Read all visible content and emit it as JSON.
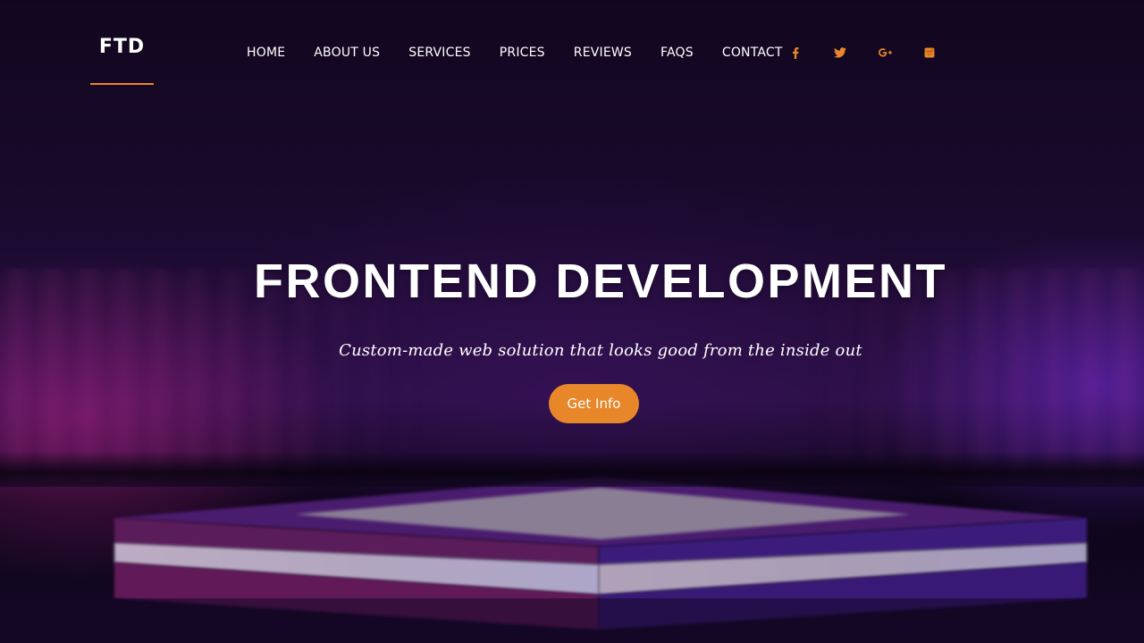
{
  "header": {
    "logo": "FTD",
    "nav": [
      {
        "label": "HOME"
      },
      {
        "label": "ABOUT US"
      },
      {
        "label": "SERVICES"
      },
      {
        "label": "PRICES"
      },
      {
        "label": "REVIEWS"
      },
      {
        "label": "FAQS"
      },
      {
        "label": "CONTACT"
      }
    ],
    "social": [
      {
        "icon": "facebook-icon"
      },
      {
        "icon": "twitter-icon"
      },
      {
        "icon": "google-plus-icon"
      },
      {
        "icon": "instagram-icon"
      }
    ]
  },
  "hero": {
    "title": "FRONTEND DEVELOPMENT",
    "subtitle": "Custom-made web solution that looks good from the inside out",
    "cta_label": "Get Info"
  },
  "colors": {
    "accent": "#e8862a",
    "background": "#1a0a2e",
    "text": "#ffffff"
  }
}
